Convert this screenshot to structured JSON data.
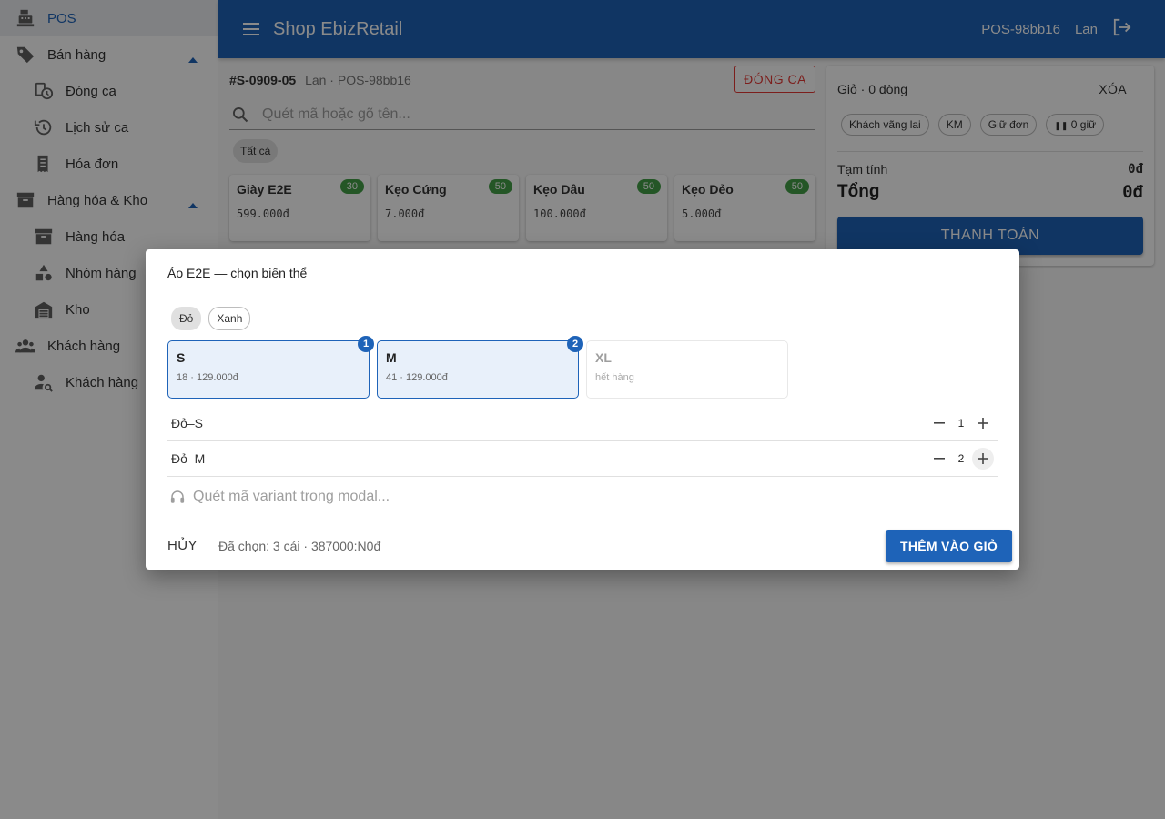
{
  "colors": {
    "primary": "#1e63b8",
    "danger": "#e53935",
    "stock_badge": "#43a047"
  },
  "sidebar": {
    "items": [
      {
        "label": "POS",
        "icon": "cash-register-icon",
        "active": true
      },
      {
        "label": "Bán hàng",
        "icon": "tag-icon",
        "expanded": true
      },
      {
        "label": "Đóng ca",
        "icon": "clock-history-icon"
      },
      {
        "label": "Lịch sử ca",
        "icon": "history-icon"
      },
      {
        "label": "Hóa đơn",
        "icon": "receipt-icon"
      },
      {
        "label": "Hàng hóa & Kho",
        "icon": "archive-icon",
        "expanded": true
      },
      {
        "label": "Hàng hóa",
        "icon": "archive-box-icon"
      },
      {
        "label": "Nhóm hàng",
        "icon": "category-shapes-icon"
      },
      {
        "label": "Kho",
        "icon": "warehouse-icon"
      },
      {
        "label": "Khách hàng",
        "icon": "people-icon"
      },
      {
        "label": "Khách hàng",
        "icon": "person-search-icon"
      }
    ]
  },
  "topbar": {
    "title": "Shop EbizRetail",
    "terminal": "POS-98bb16",
    "user": "Lan",
    "logout_icon": "logout-icon",
    "menu_icon": "menu-icon"
  },
  "shift": {
    "code": "#S-0909-05",
    "meta": "Lan · POS-98bb16",
    "close_label": "ĐÓNG CA"
  },
  "search": {
    "placeholder": "Quét mã hoặc gõ tên..."
  },
  "filter": {
    "all_label": "Tất cả"
  },
  "products": [
    {
      "name": "Giày E2E",
      "price": "599.000đ",
      "stock": "30"
    },
    {
      "name": "Kẹo Cứng",
      "price": "7.000đ",
      "stock": "50"
    },
    {
      "name": "Kẹo Dâu",
      "price": "100.000đ",
      "stock": "50"
    },
    {
      "name": "Kẹo Dẻo",
      "price": "5.000đ",
      "stock": "50"
    }
  ],
  "cart": {
    "title": "Giỏ · 0 dòng",
    "clear_label": "XÓA",
    "chips": {
      "guest": "Khách vãng lai",
      "promo": "KM",
      "hold": "Giữ đơn",
      "held": "0 giữ"
    },
    "subtotal_label": "Tạm tính",
    "subtotal_value": "0đ",
    "total_label": "Tổng",
    "total_value": "0đ",
    "pay_label": "THANH TOÁN"
  },
  "dialog": {
    "title": "Áo E2E — chọn biến thể",
    "colors": [
      {
        "label": "Đỏ",
        "selected": true
      },
      {
        "label": "Xanh",
        "selected": false
      }
    ],
    "sizes": [
      {
        "name": "S",
        "info": "18 · 129.000đ",
        "count": "1",
        "selected": true
      },
      {
        "name": "M",
        "info": "41 · 129.000đ",
        "count": "2",
        "selected": true
      },
      {
        "name": "XL",
        "info": "hết hàng",
        "count": "",
        "selected": false
      }
    ],
    "lines": [
      {
        "name": "Đỏ–S",
        "qty": "1"
      },
      {
        "name": "Đỏ–M",
        "qty": "2"
      }
    ],
    "variant_placeholder": "Quét mã variant trong modal...",
    "cancel_label": "HỦY",
    "summary": "Đã chọn: 3 cái · 387000:N0đ",
    "add_label": "THÊM VÀO GIỎ"
  }
}
